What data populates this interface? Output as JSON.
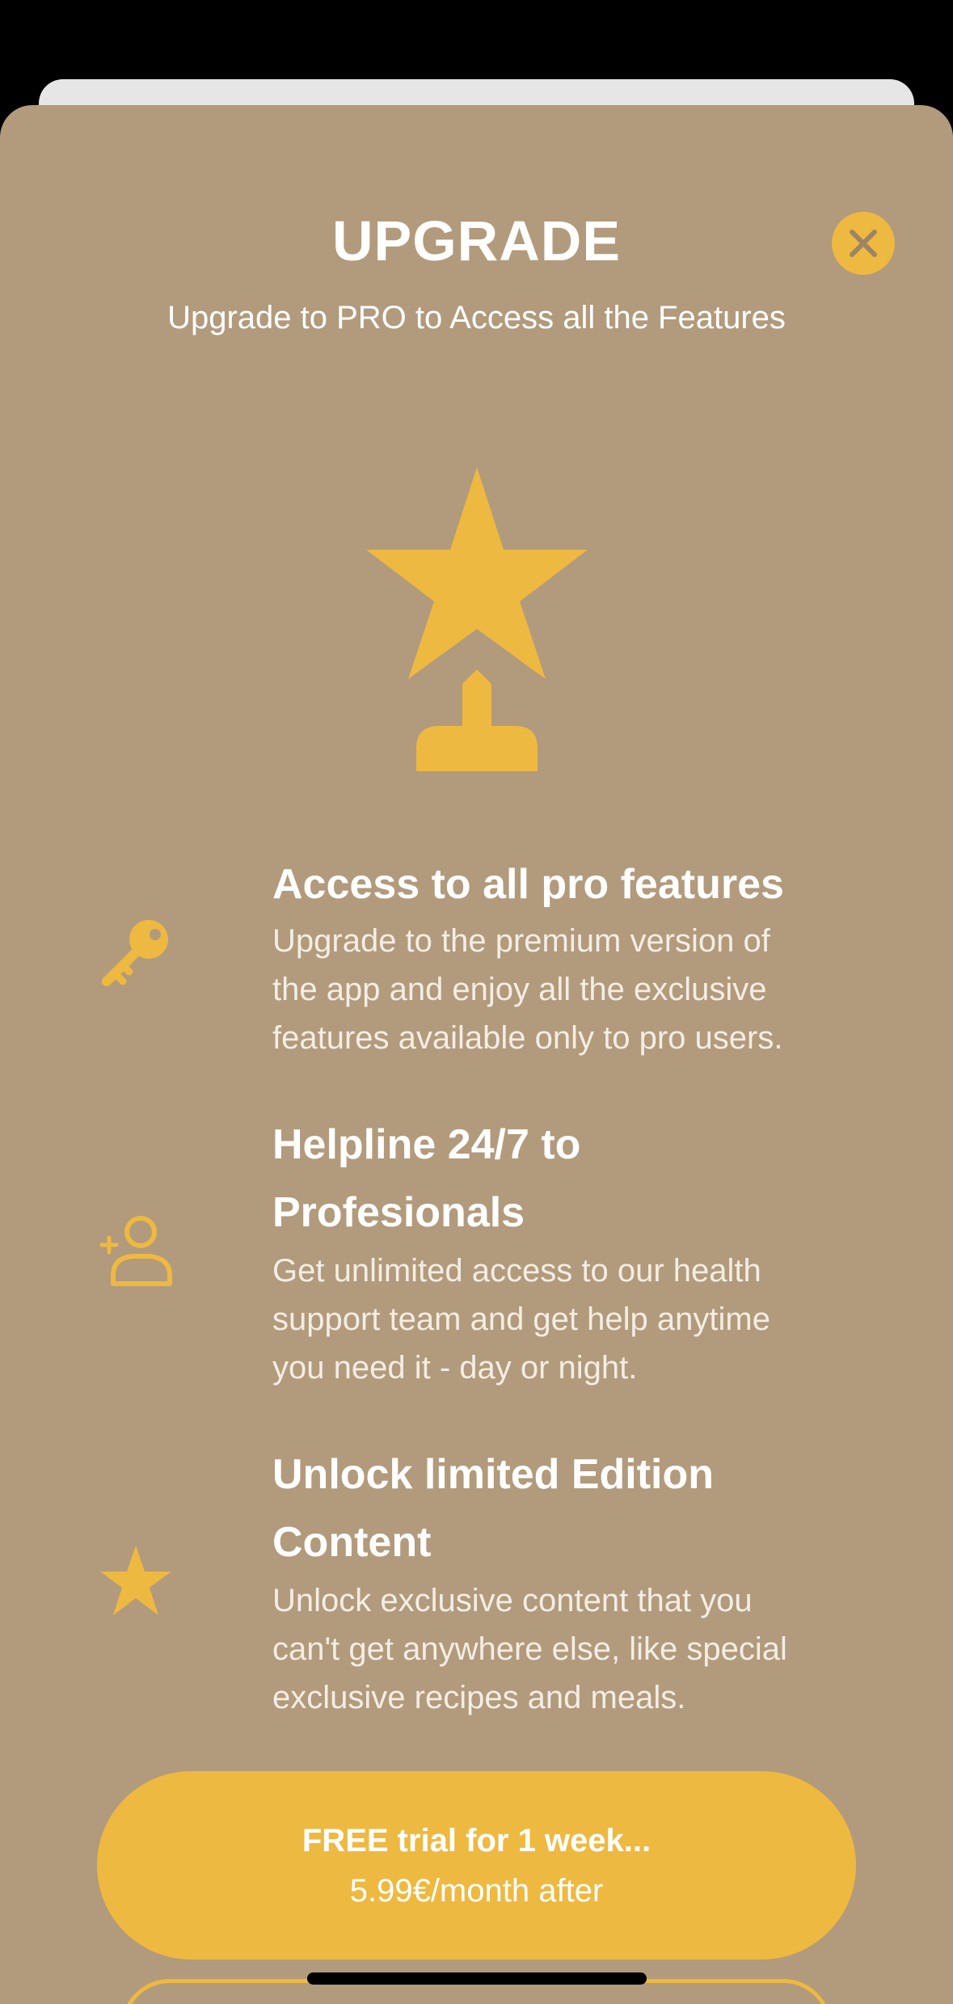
{
  "header": {
    "title": "UPGRADE",
    "subtitle": "Upgrade to PRO to Access all the Features"
  },
  "hero": {
    "icon": "trophy-star-icon"
  },
  "features": [
    {
      "icon": "key-icon",
      "title": "Access to all pro features",
      "description_lines": [
        "Upgrade to the premium version of",
        "the app and enjoy all the exclusive",
        "features available only to pro users."
      ]
    },
    {
      "icon": "add-person-icon",
      "title_lines": [
        "Helpline 24/7 to",
        "Profesionals"
      ],
      "description_lines": [
        "Get unlimited access to our health",
        "support team and get help anytime",
        "you need it - day or night."
      ]
    },
    {
      "icon": "star-icon",
      "title_lines": [
        "Unlock limited Edition",
        "Content"
      ],
      "description_lines": [
        "Unlock exclusive content that you",
        "can't get anywhere else, like special",
        "exclusive recipes and meals."
      ]
    }
  ],
  "cta": {
    "line1": "FREE trial for 1 week...",
    "line2": "5.99€/month after"
  },
  "colors": {
    "background": "#b29a7c",
    "accent": "#eeb940",
    "text": "#ffffff"
  }
}
